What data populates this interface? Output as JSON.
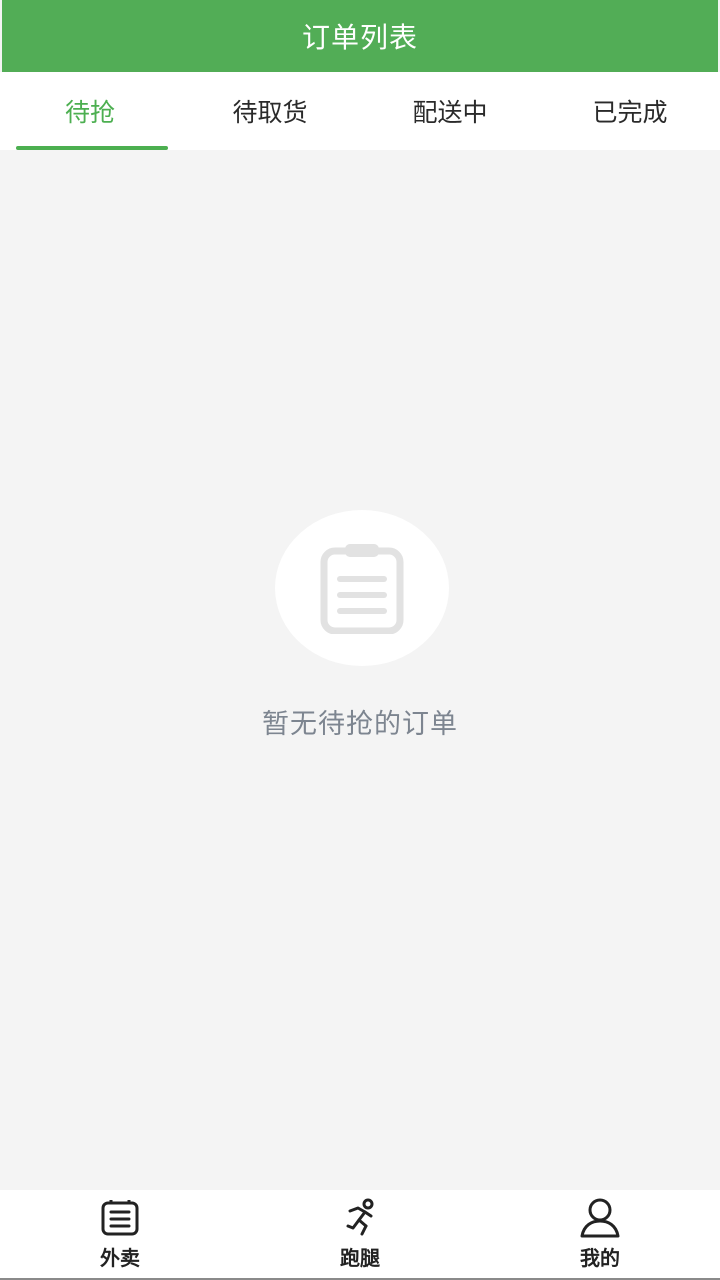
{
  "header": {
    "title": "订单列表"
  },
  "tabs": [
    {
      "label": "待抢",
      "active": true
    },
    {
      "label": "待取货",
      "active": false
    },
    {
      "label": "配送中",
      "active": false
    },
    {
      "label": "已完成",
      "active": false
    }
  ],
  "empty_state": {
    "icon": "clipboard-icon",
    "message": "暂无待抢的订单"
  },
  "bottom_nav": {
    "items": [
      {
        "label": "外卖",
        "icon": "list-document-icon"
      },
      {
        "label": "跑腿",
        "icon": "runner-icon"
      },
      {
        "label": "我的",
        "icon": "user-icon"
      }
    ]
  },
  "colors": {
    "brand_green": "#52ad56",
    "active_tab": "#4caf50",
    "background": "#f4f4f4",
    "empty_text": "#7d8590"
  }
}
